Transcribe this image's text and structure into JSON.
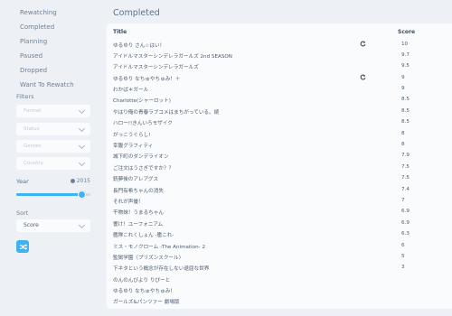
{
  "sidebar": {
    "statuses": [
      "Rewatching",
      "Completed",
      "Planning",
      "Paused",
      "Dropped",
      "Want To Rewatch"
    ],
    "filters_label": "Filters",
    "filters": [
      "Format",
      "Status",
      "Genres",
      "Country"
    ],
    "year_label": "Year",
    "year_value": "2015",
    "year_fraction": 0.88,
    "sort_label": "Sort",
    "sort_value": "Score"
  },
  "main": {
    "title": "Completed",
    "columns": {
      "title": "Title",
      "score": "Score"
    },
    "rows": [
      {
        "title": "ゆるゆり さん☆はい！",
        "score": "10",
        "repeat": true
      },
      {
        "title": "アイドルマスターシンデレラガールズ 2nd SEASON",
        "score": "9.7",
        "repeat": false
      },
      {
        "title": "アイドルマスターシンデレラガールズ",
        "score": "9.5",
        "repeat": false
      },
      {
        "title": "ゆるゆり なちゅやちゅみ！＋",
        "score": "9",
        "repeat": true
      },
      {
        "title": "わかば＊ガール",
        "score": "9",
        "repeat": false
      },
      {
        "title": "Charlotte(シャーロット)",
        "score": "8.5",
        "repeat": false
      },
      {
        "title": "やはり俺の青春ラブコメはまちがっている。続",
        "score": "8.5",
        "repeat": false
      },
      {
        "title": "ハロー!!きんいろモザイク",
        "score": "8.5",
        "repeat": false
      },
      {
        "title": "がっこうぐらし!",
        "score": "8",
        "repeat": false
      },
      {
        "title": "幸腹グラフィティ",
        "score": "8",
        "repeat": false
      },
      {
        "title": "城下町のダンデライオン",
        "score": "7.9",
        "repeat": false
      },
      {
        "title": "ご注文はうさぎですか？？",
        "score": "7.5",
        "repeat": false
      },
      {
        "title": "銃夢後のアレアグス",
        "score": "7.5",
        "repeat": false
      },
      {
        "title": "長門有希ちゃんの消失",
        "score": "7.4",
        "repeat": false
      },
      {
        "title": "それが声優！",
        "score": "7",
        "repeat": false
      },
      {
        "title": "干物妹！うまるちゃん",
        "score": "6.9",
        "repeat": false
      },
      {
        "title": "響け！ユーフォニアム",
        "score": "6.9",
        "repeat": false
      },
      {
        "title": "艦隊これくしょん -艦これ-",
        "score": "6.3",
        "repeat": false
      },
      {
        "title": "ミス・モノクローム -The Animation- 2",
        "score": "6",
        "repeat": false
      },
      {
        "title": "監獄学園〈プリズンスクール〉",
        "score": "5",
        "repeat": false
      },
      {
        "title": "下ネタという概念が存在しない退屈な世界",
        "score": "3",
        "repeat": false
      },
      {
        "title": "のんのんびより りぴーと",
        "score": "",
        "repeat": false
      },
      {
        "title": "ゆるゆり なちゅやちゅみ！",
        "score": "",
        "repeat": false
      },
      {
        "title": "ガールズ&パンツァー 劇場版",
        "score": "",
        "repeat": false
      }
    ]
  }
}
